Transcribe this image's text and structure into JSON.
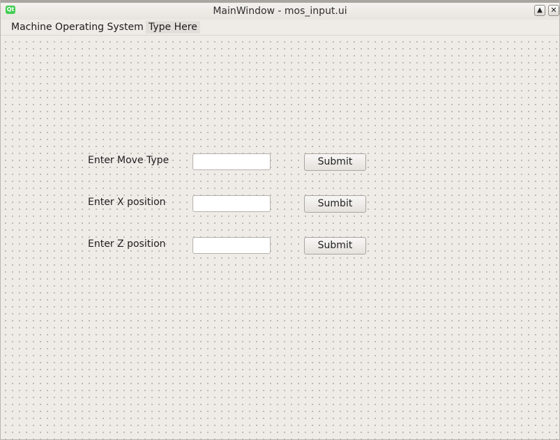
{
  "window": {
    "title": "MainWindow - mos_input.ui",
    "app_icon_text": "Qt",
    "maximize_glyph": "▲",
    "close_glyph": "✕"
  },
  "menubar": {
    "items": [
      {
        "label": "Machine Operating System"
      },
      {
        "label": "Type Here"
      }
    ]
  },
  "form": {
    "rows": [
      {
        "label": "Enter Move Type",
        "input_value": "",
        "button_label": "Submit"
      },
      {
        "label": "Enter X position",
        "input_value": "",
        "button_label": "Sumbit"
      },
      {
        "label": "Enter Z position",
        "input_value": "",
        "button_label": "Submit"
      }
    ]
  }
}
